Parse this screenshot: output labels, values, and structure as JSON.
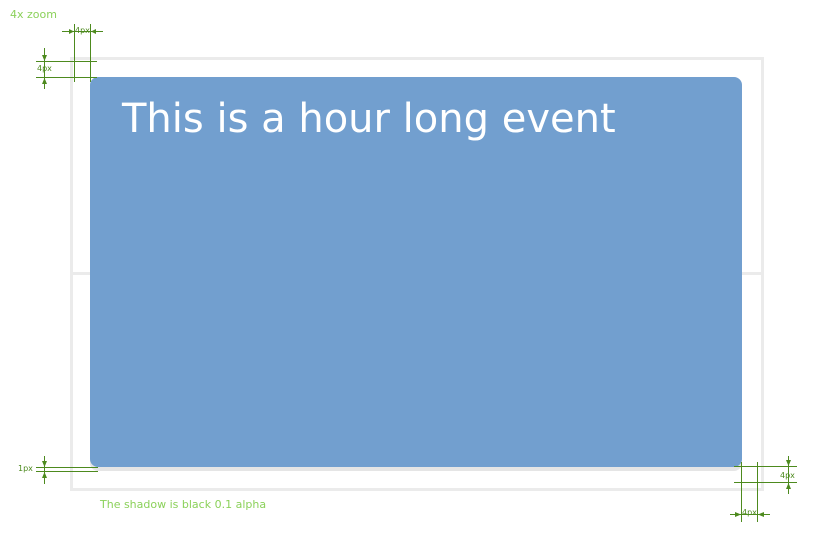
{
  "annotations": {
    "zoom_note": "4x zoom",
    "shadow_note": "The shadow is black 0.1 alpha"
  },
  "event": {
    "title": "This is a hour long event",
    "color": "#729fcf",
    "shadow_color": "rgba(0,0,0,0.1)"
  },
  "dimensions": {
    "top_left_horizontal": "4px",
    "top_left_vertical": "4px",
    "bottom_left_shadow": "1px",
    "bottom_right_vertical": "4px",
    "bottom_right_horizontal": "4px"
  },
  "colors": {
    "annotation_green": "#8bd15a",
    "guide_green": "#4d8a1e",
    "grid_gray": "#ebebeb"
  }
}
